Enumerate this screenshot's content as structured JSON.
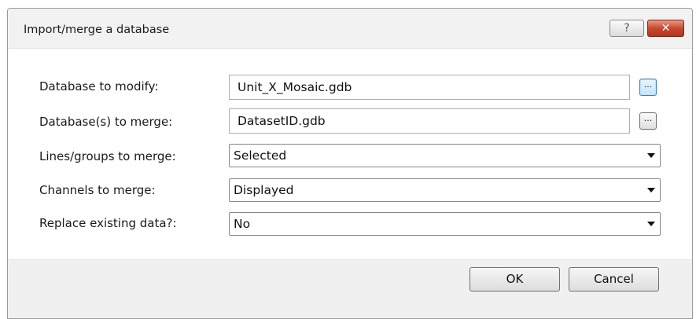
{
  "dialog": {
    "title": "Import/merge a database",
    "help_button": "?",
    "close_button": "✕"
  },
  "fields": {
    "database_to_modify": {
      "label": "Database to modify:",
      "value": "Unit_X_Mosaic.gdb",
      "browse": "..."
    },
    "databases_to_merge": {
      "label": "Database(s) to merge:",
      "value": "DatasetID.gdb",
      "browse": "..."
    },
    "lines_groups": {
      "label": "Lines/groups to merge:",
      "selected": "Selected"
    },
    "channels": {
      "label": "Channels to merge:",
      "selected": "Displayed"
    },
    "replace": {
      "label": "Replace existing data?:",
      "selected": "No"
    }
  },
  "buttons": {
    "ok": "OK",
    "cancel": "Cancel"
  },
  "colors": {
    "close_button": "#c74a2e",
    "browse_active": "#bee6fd"
  }
}
